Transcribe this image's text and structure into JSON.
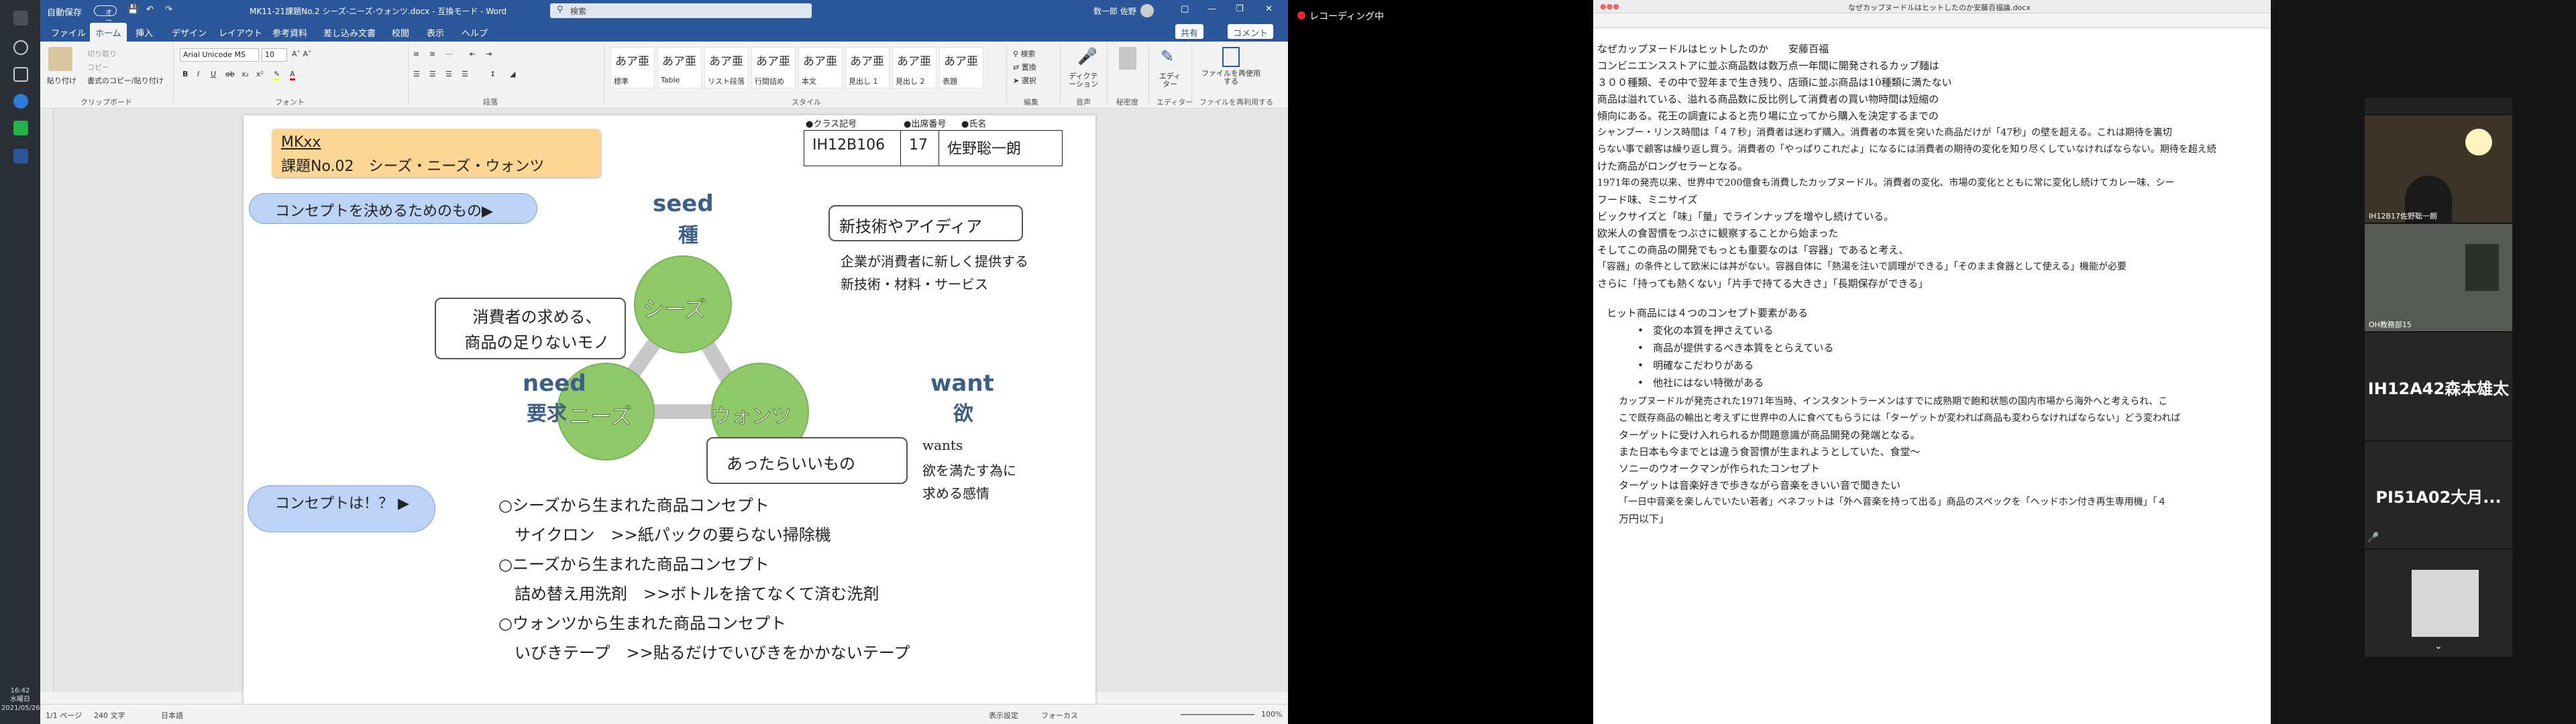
{
  "taskbar": {
    "time": "16:42",
    "day": "水曜日",
    "date": "2021/05/26"
  },
  "word": {
    "autosave_label": "自動保存",
    "autosave_state": "オフ",
    "title": "MK11-21課題No.2 シーズ-ニーズ-ウォンツ.docx - 互換モード - Word",
    "search_placeholder": "検索",
    "user_name": "数一郎 佐野",
    "share_label": "共有",
    "comment_label": "コメント",
    "tabs": [
      "ファイル",
      "ホーム",
      "挿入",
      "デザイン",
      "レイアウト",
      "参考資料",
      "差し込み文書",
      "校閲",
      "表示",
      "ヘルプ"
    ],
    "active_tab": "ホーム",
    "ribbon": {
      "clipboard": {
        "paste": "貼り付け",
        "cut": "切り取り",
        "copy": "コピー",
        "format_painter": "書式のコピー/貼り付け",
        "label": "クリップボード"
      },
      "font": {
        "name": "Arial Unicode MS",
        "size": "10",
        "label": "フォント"
      },
      "paragraph": {
        "label": "段落"
      },
      "styles": {
        "label": "スタイル",
        "items": [
          {
            "sample": "あア亜",
            "name": "標準"
          },
          {
            "sample": "あア亜",
            "name": "Table"
          },
          {
            "sample": "あア亜",
            "name": "リスト段落"
          },
          {
            "sample": "あア亜",
            "name": "行間詰め"
          },
          {
            "sample": "あア亜",
            "name": "本文"
          },
          {
            "sample": "あア亜",
            "name": "見出し 1"
          },
          {
            "sample": "あア亜",
            "name": "見出し 2"
          },
          {
            "sample": "あア亜",
            "name": "表題"
          }
        ]
      },
      "editing": {
        "find": "検索",
        "replace": "置換",
        "select": "選択",
        "label": "編集"
      },
      "voice": {
        "dictate": "ディクテーション",
        "label": "音声"
      },
      "sensitivity": {
        "label": "秘密度"
      },
      "editor": {
        "name": "エディター",
        "label": "エディター"
      },
      "reuse": {
        "name": "ファイルを再使用する",
        "label": "ファイルを再利用する"
      }
    },
    "status": {
      "page": "1/1 ページ",
      "words": "240 文字",
      "lang": "日本語",
      "display": "表示設定",
      "focus": "フォーカス",
      "zoom": "100%"
    }
  },
  "document": {
    "title_line1": "MKxx",
    "title_line2": "課題No.02　シーズ・ニーズ・ウォンツ",
    "header_labels": {
      "class": "●クラス記号",
      "number": "●出席番号",
      "name": "●氏名"
    },
    "student": {
      "class": "IH12B106",
      "number": "17",
      "name": "佐野聡一朗"
    },
    "concept_banner": "コンセプトを決めるためのもの▶",
    "seed_label": "seed",
    "seed_kanji": "種",
    "need_label": "need",
    "need_kanji": "要求",
    "want_label": "want",
    "want_kanji": "欲",
    "circle_seeds": "シーズ",
    "circle_needs": "ニーズ",
    "circle_wants": "ウォンツ",
    "callout_seeds": "新技術やアイディア",
    "callout_needs_1": "消費者の求める、",
    "callout_needs_2": "商品の足りないモノ",
    "callout_wants": "あったらいいもの",
    "seeds_desc_1": "企業が消費者に新しく提供する",
    "seeds_desc_2": "新技術・材料・サービス",
    "wants_desc_1": "wants",
    "wants_desc_2": "欲を満たす為に",
    "wants_desc_3": "求める感情",
    "concept_q": "コンセプトは！？ ▶",
    "lines": [
      "○シーズから生まれた商品コンセプト",
      "　サイクロン　>>紙パックの要らない掃除機",
      "○ニーズから生まれた商品コンセプト",
      "　詰め替え用洗剤　>>ボトルを捨てなくて済む洗剤",
      "○ウォンツから生まれた商品コンセプト",
      "　いびきテープ　>>貼るだけでいびきをかかないテープ"
    ]
  },
  "recording": {
    "label": "レコーディング中"
  },
  "doc2": {
    "title": "なぜカップヌードルはヒットしたのか安藤百福論.docx",
    "lines": [
      "なぜカップヌードルはヒットしたのか　　安藤百福",
      "コンビニエンスストアに並ぶ商品数は数万点一年間に開発されるカップ麺は",
      "３００種類、その中で翌年まで生き残り、店頭に並ぶ商品は10種類に満たない",
      "商品は溢れている、溢れる商品数に反比例して消費者の買い物時間は短縮の",
      "傾向にある。花王の調査によると売り場に立ってから購入を決定するまでの",
      "シャンプー・リンス時間は「４７秒」消費者は迷わず購入。消費者の本質を突いた商品だけが「47秒」の壁を超える。これは期待を裏切",
      "らない事で顧客は繰り返し買う。消費者の「やっぱりこれだよ」になるには消費者の期待の変化を知り尽くしていなければならない。期待を超え続",
      "けた商品がロングセラーとなる。",
      "1971年の発売以来、世界中で200億食も消費したカップヌードル。消費者の変化、市場の変化とともに常に変化し続けてカレー味、シー",
      "フード味、ミニサイズ",
      "ビックサイズと「味」「量」でラインナップを増やし続けている。",
      "欧米人の食習慣をつぶさに観察することから始まった",
      "そしてこの商品の開発でもっとも重要なのは「容器」であると考え、",
      "「容器」の条件として欧米には丼がない。容器自体に「熱湯を注いで調理ができる」「そのまま食器として使える」機能が必要",
      "さらに「持っても熱くない」「片手で持てる大きさ」「長期保存ができる」"
    ],
    "section": "ヒット商品には４つのコンセプト要素がある",
    "bullets": [
      "変化の本質を押さえている",
      "商品が提供するべき本質をとらえている",
      "明確なこだわりがある",
      "他社にはない特徴がある"
    ],
    "para2": [
      "カップヌードルが発売された1971年当時、インスタントラーメンはすでに成熟期で飽和状態の国内市場から海外へと考えられ、こ",
      "こで既存商品の輸出と考えずに世界中の人に食べてもらうには「ターゲットが変われば商品も変わらなければならない」どう変われば",
      "ターゲットに受け入れられるか問題意識が商品開発の発端となる。",
      "また日本も今までとは違う食習慣が生まれようとしていた、食堂～",
      "ソニーのウオークマンが作られたコンセプト",
      "ターゲットは音楽好きで歩きながら音楽をきいい音で聞きたい",
      "「一日中音楽を楽しんでいたい若者」ベネフットは「外へ音楽を持って出る」商品のスペックを「ヘッドホン付き再生専用機」「４",
      "万円以下」"
    ]
  },
  "zoom": {
    "p1_name": "IH12B17佐野聡一朗",
    "p2_name": "OH教務部15",
    "p3_name": "IH12A42森本雄太",
    "p4_name": "PI51A02大月..."
  },
  "colors": {
    "word_blue": "#2b579a",
    "circle_green": "#8fc96a",
    "banner_blue": "#bcd3f5",
    "title_orange": "#fbd694"
  }
}
